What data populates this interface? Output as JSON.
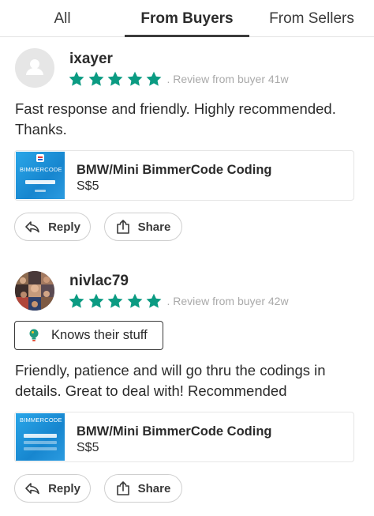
{
  "tabs": [
    {
      "label": "All"
    },
    {
      "label": "From Buyers"
    },
    {
      "label": "From Sellers"
    }
  ],
  "colors": {
    "star": "#0b9b82",
    "meta": "#a9a9a9",
    "text": "#2b2b2b",
    "border": "#cfcfcf"
  },
  "reviews": [
    {
      "username": "ixayer",
      "rating": 5,
      "meta": ". Review from buyer",
      "age": "41w",
      "text": "Fast response and friendly. Highly recommended. Thanks.",
      "listing": {
        "thumb_brand": "BIMMERCODE",
        "title": "BMW/Mini BimmerCode Coding",
        "price": "S$5"
      },
      "reply_label": "Reply",
      "share_label": "Share"
    },
    {
      "username": "nivlac79",
      "rating": 5,
      "meta": ". Review from buyer",
      "age": "42w",
      "badge": "Knows their stuff",
      "text": "Friendly, patience and will go thru the codings in details. Great to deal with! Recommended",
      "listing": {
        "thumb_brand": "BIMMERCODE",
        "title": "BMW/Mini BimmerCode Coding",
        "price": "S$5"
      },
      "reply_label": "Reply",
      "share_label": "Share"
    }
  ]
}
